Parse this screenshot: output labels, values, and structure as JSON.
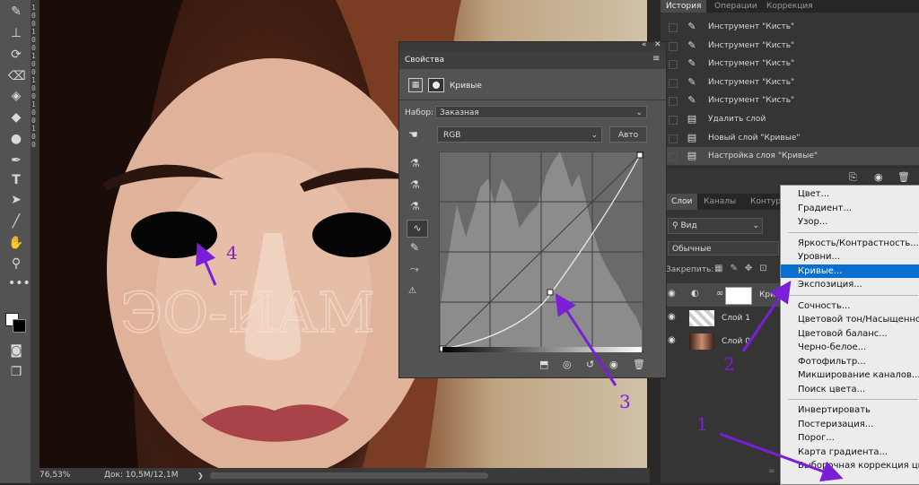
{
  "statusbar": {
    "zoom": "76,53%",
    "doc": "Док: 10,5M/12,1M"
  },
  "ruler_digits": [
    "1",
    "0",
    "0",
    "1",
    "0",
    "0",
    "1",
    "0",
    "0",
    "1",
    "0",
    "0",
    "1",
    "0",
    "0",
    "1",
    "0",
    "0"
  ],
  "history": {
    "tabs": [
      "История",
      "Операции",
      "Коррекция"
    ],
    "items": [
      {
        "label": "Инструмент \"Кисть\"",
        "icon": "brush-icon"
      },
      {
        "label": "Инструмент \"Кисть\"",
        "icon": "brush-icon"
      },
      {
        "label": "Инструмент \"Кисть\"",
        "icon": "brush-icon"
      },
      {
        "label": "Инструмент \"Кисть\"",
        "icon": "brush-icon"
      },
      {
        "label": "Инструмент \"Кисть\"",
        "icon": "brush-icon"
      },
      {
        "label": "Удалить слой",
        "icon": "document-icon"
      },
      {
        "label": "Новый слой \"Кривые\"",
        "icon": "document-icon"
      },
      {
        "label": "Настройка слоя \"Кривые\"",
        "icon": "document-icon"
      }
    ]
  },
  "layers": {
    "tabs": [
      "Слои",
      "Каналы",
      "Контур"
    ],
    "filter": "Вид",
    "blend_mode": "Обычные",
    "lock_label": "Закрепить:",
    "rows": [
      {
        "name": "Криі"
      },
      {
        "name": "Слой 1"
      },
      {
        "name": "Слой 0"
      }
    ]
  },
  "properties": {
    "title": "Свойства",
    "type": "Кривые",
    "preset_label": "Набор:",
    "preset_value": "Заказная",
    "channel": "RGB",
    "auto_button": "Авто"
  },
  "menu": {
    "group1": [
      "Цвет...",
      "Градиент...",
      "Узор..."
    ],
    "group2": [
      "Яркость/Контрастность...",
      "Уровни...",
      "Кривые...",
      "Экспозиция..."
    ],
    "group3": [
      "Сочность...",
      "Цветовой тон/Насыщенность...",
      "Цветовой баланс...",
      "Черно-белое...",
      "Фотофильтр...",
      "Микширование каналов...",
      "Поиск цвета..."
    ],
    "group4": [
      "Инвертировать",
      "Постеризация...",
      "Порог...",
      "Карта градиента...",
      "Выборочная коррекция цвета..."
    ],
    "highlighted": "Кривые..."
  },
  "canvas": {
    "watermark": "ЭО-ИАМ"
  },
  "annotations": [
    "1",
    "2",
    "3",
    "4"
  ],
  "colors": {
    "accent_menu": "#0a6fd1",
    "annotation": "#7a1fd6"
  }
}
